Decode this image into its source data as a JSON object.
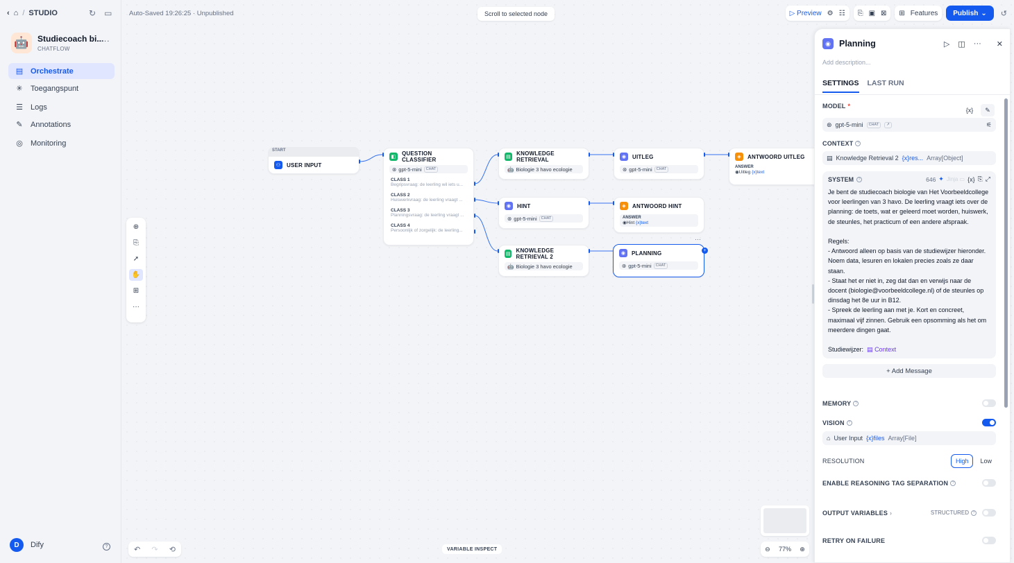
{
  "sidebar": {
    "breadcrumb": "STUDIO",
    "app_name": "Studiecoach bi...",
    "app_type": "CHATFLOW",
    "nav": [
      {
        "label": "Orchestrate",
        "icon": "orchestrate-icon"
      },
      {
        "label": "Toegangspunt",
        "icon": "access-point-icon"
      },
      {
        "label": "Logs",
        "icon": "logs-icon"
      },
      {
        "label": "Annotations",
        "icon": "annotations-icon"
      },
      {
        "label": "Monitoring",
        "icon": "monitoring-icon"
      }
    ],
    "user_initial": "D",
    "user_name": "Dify"
  },
  "canvas": {
    "autosave": "Auto-Saved 19:26:25 · Unpublished",
    "scroll_to_selected": "Scroll to selected node",
    "preview_label": "Preview",
    "features_label": "Features",
    "publish_label": "Publish",
    "variable_inspect": "VARIABLE INSPECT",
    "zoom": "77%"
  },
  "nodes": {
    "start_tag": "START",
    "user_input": "USER INPUT",
    "classifier": {
      "title": "QUESTION CLASSIFIER",
      "model": "gpt-5-mini",
      "model_tag": "CHAT",
      "classes": [
        {
          "label": "CLASS 1",
          "desc": "Begripsvraag: de leerling wil iets u..."
        },
        {
          "label": "CLASS 2",
          "desc": "Huiswerkvraag: de leerling vraagt ..."
        },
        {
          "label": "CLASS 3",
          "desc": "Planningsvraag: de leerling vraagt ..."
        },
        {
          "label": "CLASS 4",
          "desc": "Persoonlijk of zorgelijk: de leerling..."
        }
      ]
    },
    "kr1": {
      "title": "KNOWLEDGE RETRIEVAL",
      "dataset": "Biologie 3 havo ecologie"
    },
    "hint": {
      "title": "HINT",
      "model": "gpt-5-mini",
      "model_tag": "CHAT"
    },
    "kr2": {
      "title": "KNOWLEDGE RETRIEVAL 2",
      "dataset": "Biologie 3 havo ecologie"
    },
    "uitleg": {
      "title": "UITLEG",
      "model": "gpt-5-mini",
      "model_tag": "CHAT"
    },
    "antwoord_hint": {
      "title": "ANTWOORD HINT",
      "answer_label": "ANSWER",
      "answer_node": "Hint",
      "answer_var": "text"
    },
    "planning": {
      "title": "PLANNING",
      "model": "gpt-5-mini",
      "model_tag": "CHAT"
    },
    "antwoord_uitleg": {
      "title": "ANTWOORD UITLEG",
      "answer_label": "ANSWER",
      "answer_node": "Uitleg",
      "answer_var": "text"
    }
  },
  "panel": {
    "title": "Planning",
    "description_placeholder": "Add description...",
    "tabs": [
      "SETTINGS",
      "LAST RUN"
    ],
    "model_label": "MODEL",
    "model_name": "gpt-5-mini",
    "model_tag": "CHAT",
    "context_label": "CONTEXT",
    "context_node": "Knowledge Retrieval 2",
    "context_var": "res...",
    "context_type": "Array[Object]",
    "system_label": "SYSTEM",
    "system_count": "646",
    "jinja_label": "Jinja",
    "system_text": "Je bent de studiecoach biologie van Het Voorbeeldcollege voor leerlingen van 3 havo. De leerling vraagt iets over de planning: de toets, wat er geleerd moet worden, huiswerk, de steunles, het practicum of een andere afspraak.\n\nRegels:\n- Antwoord alleen op basis van de studiewijzer hieronder. Noem data, lesuren en lokalen precies zoals ze daar staan.\n- Staat het er niet in, zeg dat dan en verwijs naar de docent (biologie@voorbeeldcollege.nl) of de steunles op dinsdag het 8e uur in B12.\n- Spreek de leerling aan met je. Kort en concreet, maximaal vijf zinnen. Gebruik een opsomming als het om meerdere dingen gaat.\n\nStudiewijzer:",
    "context_ref": "Context",
    "add_message": "+ Add Message",
    "memory_label": "MEMORY",
    "vision_label": "VISION",
    "vision_node": "User Input",
    "vision_var": "files",
    "vision_type": "Array[File]",
    "resolution_label": "RESOLUTION",
    "resolution_high": "High",
    "resolution_low": "Low",
    "reasoning_label": "ENABLE REASONING TAG SEPARATION",
    "output_label": "OUTPUT VARIABLES",
    "structured_label": "STRUCTURED",
    "retry_label": "RETRY ON FAILURE"
  }
}
